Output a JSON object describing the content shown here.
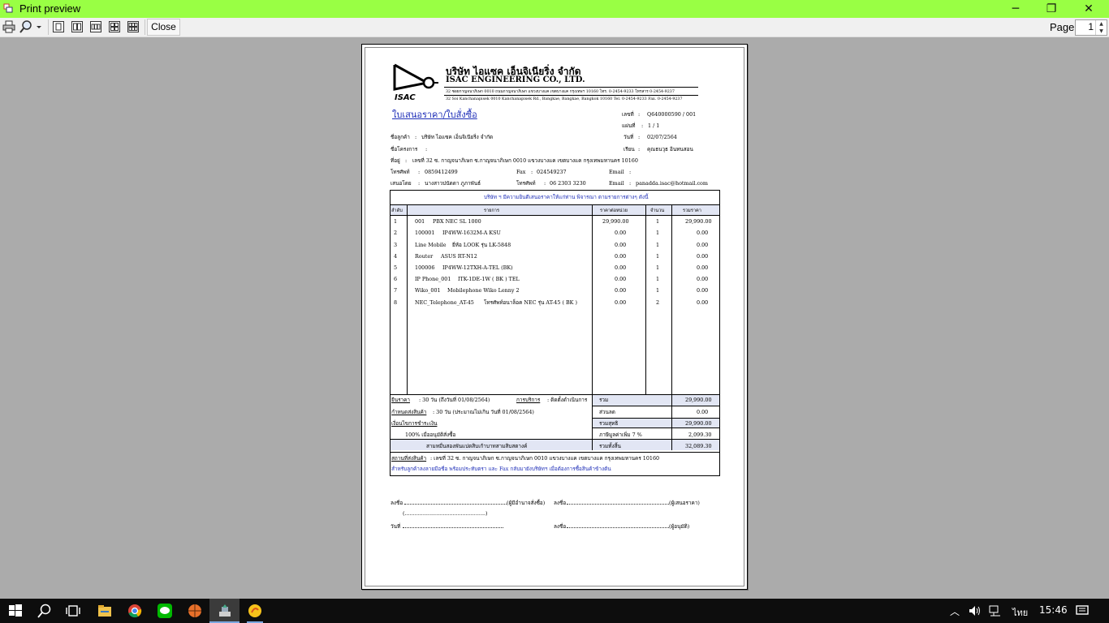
{
  "window": {
    "title": "Print preview",
    "controls": {
      "minimize": "─",
      "maximize": "❐",
      "close": "✕"
    }
  },
  "toolbar": {
    "close_label": "Close",
    "page_label": "Page",
    "page_value": "1",
    "icons": [
      "print-icon",
      "zoom-icon",
      "one-page-icon",
      "two-pages-icon",
      "three-pages-icon",
      "four-pages-icon",
      "six-pages-icon"
    ]
  },
  "doc": {
    "company_th": "บริษัท ไอแซค เอ็นจิเนียริ่ง จำกัด",
    "company_en": "ISAC ENGINEERING CO., LTD.",
    "logo_text": "ISAC",
    "address_th": "32 ซอยกาญจนาภิเษก 0010 ถนนกาญจนาภิเษก แขวงบางแค เขตบางแค กรุงเทพฯ 10160 โทร. 0-2454-9233 โทรสาร 0-2454-9237",
    "address_en": "32 Soi Kanchanapisek 0010 Kanchanapisek Rd., Bangkae, Bangkae, Bangkok 10160 Tel. 0-2454-9233 Fax. 0-2454-9237",
    "title": "ใบเสนอราคา/ใบสั่งซื้อ",
    "right_info": [
      {
        "label": "เลขที่",
        "value": "Q640000590 / 001"
      },
      {
        "label": "แผ่นที่",
        "value": "1 / 1"
      },
      {
        "label": "วันที่",
        "value": "02/07/2564"
      },
      {
        "label": "เรียน",
        "value": "คุณธนวุธ อินทนสอน"
      }
    ],
    "customer_label": "ชื่อลูกค้า",
    "customer": "บริษัท ไอแซค เอ็นจิเนียริ่ง จำกัด",
    "project_label": "ชื่อโครงการ",
    "address_label": "ที่อยู่",
    "address": "เลขที่ 32 ซ. กาญจนาภิเษก ซ.กาญจนาภิเษก 0010 แขวงบางแค เขตบางแค กรุงเทพมหานคร 10160",
    "phone_label": "โทรศัพท์",
    "phone": "0859412499",
    "fax_label": "Fax",
    "fax": "024549237",
    "email_label": "Email",
    "offer_label": "เสนอโดย",
    "offer_by": "นางสาวปนัดดา ภูภาพันธ์",
    "offer_phone_label": "โทรศัพท์",
    "offer_phone": "06 2303 3230",
    "offer_email_label": "Email",
    "offer_email": "panadda.isac@hotmail.com",
    "intro": "บริษัท ฯ มีความยินดีเสนอราคาให้แก่ท่าน พิจารณา ตามรายการต่างๆ ดังนี้",
    "columns": [
      "ลำดับ",
      "รายการ",
      "ราคาต่อหน่วย",
      "จำนวน",
      "รวมราคา"
    ],
    "items": [
      {
        "no": "1",
        "code": "001",
        "desc": "PBX NEC SL 1000",
        "price": "29,990.00",
        "qty": "1",
        "total": "29,990.00"
      },
      {
        "no": "2",
        "code": "100001",
        "desc": "IP4WW-1632M-A KSU",
        "price": "0.00",
        "qty": "1",
        "total": "0.00"
      },
      {
        "no": "3",
        "code": "Line Mobile",
        "desc": "ยี่ห้อ LOOK รุ่น LK-5848",
        "price": "0.00",
        "qty": "1",
        "total": "0.00"
      },
      {
        "no": "4",
        "code": "Router",
        "desc": "ASUS RT-N12",
        "price": "0.00",
        "qty": "1",
        "total": "0.00"
      },
      {
        "no": "5",
        "code": "100006",
        "desc": "IP4WW-12TXH-A-TEL (BK)",
        "price": "0.00",
        "qty": "1",
        "total": "0.00"
      },
      {
        "no": "6",
        "code": "IP Phone_001",
        "desc": "ITK-1DE-1W ( BK ) TEL",
        "price": "0.00",
        "qty": "1",
        "total": "0.00"
      },
      {
        "no": "7",
        "code": "Wiko_001",
        "desc": "Mobilephone Wiko Lenny 2",
        "price": "0.00",
        "qty": "1",
        "total": "0.00"
      },
      {
        "no": "8",
        "code": "NEC_Telephone_AT-45",
        "desc": "โทรศัพท์อนาล็อค NEC รุ่น AT-45 ( BK )",
        "price": "0.00",
        "qty": "2",
        "total": "0.00"
      }
    ],
    "terms": {
      "price_label": "ยืนราคา",
      "price_text": ": 30 วัน (ถึงวันที่ 01/08/2564)",
      "service_label": "การบริการ",
      "service_text": ": ติดตั้งดำเนินการ",
      "delivery_label": "กำหนดส่งสินค้า",
      "delivery_text": ": 30 วัน (ประมาณไม่เกิน วันที่ 01/08/2564)",
      "payment_label": "เงื่อนไขการชำระเงิน",
      "payment_text": "100% เมื่ออนุมัติสั่งซื้อ",
      "amount_words": "สามหมื่นสองพันแปดสิบเก้าบาทสามสิบสตางค์"
    },
    "summary": [
      {
        "label": "รวม",
        "value": "29,990.00"
      },
      {
        "label": "ส่วนลด",
        "value": "0.00"
      },
      {
        "label": "รวมสุทธิ",
        "value": "29,990.00"
      },
      {
        "label": "ภาษีมูลค่าเพิ่ม 7 %",
        "value": "2,099.30"
      },
      {
        "label": "รวมทั้งสิ้น",
        "value": "32,089.30"
      }
    ],
    "ship_label": "สถานที่ส่งสินค้า",
    "ship_text": ": เลขที่ 32 ซ. กาญจนาภิเษก ซ.กาญจนาภิเษก 0010 แขวงบางแค เขตบางแค กรุงเทพมหานคร 10160",
    "note": "สำหรับลูกค้าลงลายมือชื่อ พร้อมประทับตรา และ Fax กลับมายังบริษัทฯ เมื่อต้องการซื้อสินค้าข้างต้น",
    "sign": {
      "sign_label": "ลงชื่อ",
      "buyer": "(ผู้มีอำนาจสั่งซื้อ)",
      "offerer": "(ผู้เสนอราคา)",
      "approver": "(ผู้อนุมัติ)",
      "date_label": "วันที่",
      "paren_blank": "(.................................................)"
    }
  },
  "taskbar": {
    "language": "ไทย",
    "time": "15:46",
    "icons": [
      "windows-start-icon",
      "search-icon",
      "task-view-icon",
      "file-explorer-icon",
      "chrome-icon",
      "line-icon",
      "basketball-app-icon",
      "installer-icon",
      "app-icon"
    ]
  }
}
